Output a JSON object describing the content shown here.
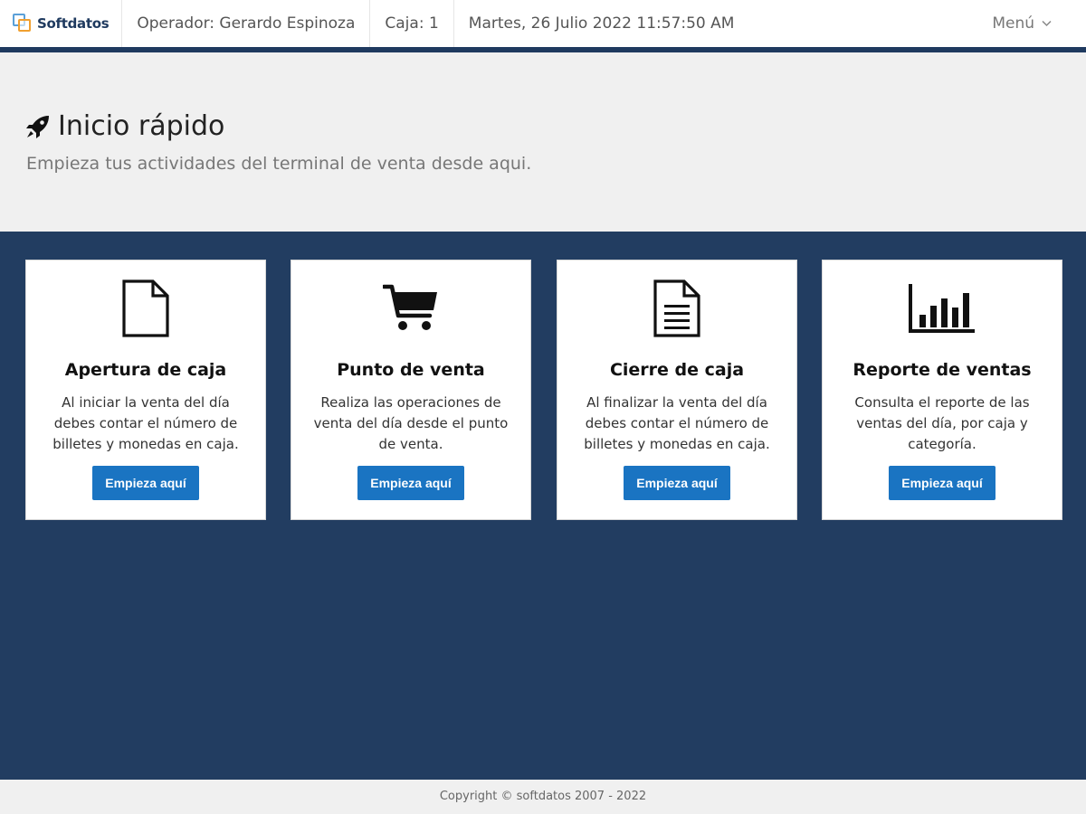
{
  "navbar": {
    "brand": "Softdatos",
    "operator": "Operador: Gerardo Espinoza",
    "register": "Caja: 1",
    "datetime": "Martes, 26 Julio 2022 11:57:50 AM",
    "menu_label": "Menú"
  },
  "hero": {
    "title": "Inicio rápido",
    "subtitle": "Empieza tus actividades del terminal de venta desde aqui."
  },
  "cards": [
    {
      "icon": "document-icon",
      "title": "Apertura de caja",
      "description": "Al iniciar la venta del día debes contar el número de billetes y monedas en caja.",
      "button": "Empieza aquí"
    },
    {
      "icon": "shopping-cart-icon",
      "title": "Punto de venta",
      "description": "Realiza las operaciones de venta del día desde el punto de venta.",
      "button": "Empieza aquí"
    },
    {
      "icon": "text-document-icon",
      "title": "Cierre de caja",
      "description": "Al finalizar la venta del día debes contar el número de billetes y monedas en caja.",
      "button": "Empieza aquí"
    },
    {
      "icon": "bar-chart-icon",
      "title": "Reporte de ventas",
      "description": "Consulta el reporte de las ventas del día, por caja y categoría.",
      "button": "Empieza aquí"
    }
  ],
  "footer": {
    "copyright": "Copyright © softdatos 2007 - 2022"
  },
  "colors": {
    "navy": "#223d61",
    "button_blue": "#1a74c2",
    "light_bg": "#f0f0f0"
  }
}
